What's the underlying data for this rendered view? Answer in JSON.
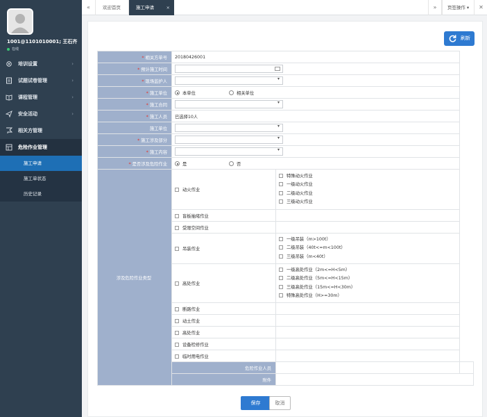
{
  "user": {
    "name": "1001@1101010001; 王石齐",
    "status": "在线"
  },
  "menu": [
    {
      "label": "培训设置",
      "icon": "gear-icon"
    },
    {
      "label": "试题试卷管理",
      "icon": "document-icon"
    },
    {
      "label": "课程管理",
      "icon": "book-icon"
    },
    {
      "label": "安全活动",
      "icon": "send-icon"
    },
    {
      "label": "相关方管理",
      "icon": "flag-icon"
    },
    {
      "label": "危险作业管理",
      "icon": "grid-icon"
    }
  ],
  "submenu": [
    "施工申请",
    "施工单状态",
    "历史记录"
  ],
  "tabs": {
    "home": "欢迎首页",
    "current": "施工申请",
    "ops": "页签操作"
  },
  "refresh_label": "刷新",
  "form": {
    "order_no_label": "相关方单号",
    "order_no": "20180426001",
    "start_time_label": "预计施工时间",
    "supervisor_label": "现场监护人",
    "unit_label": "施工单位",
    "unit_opt1": "本单位",
    "unit_opt2": "相关单位",
    "contract_label": "施工合同",
    "workers_label": "施工人员",
    "workers_value": "已选择10人",
    "unit2_label": "施工单位",
    "area_label": "施工涉及部分",
    "content_label": "施工内容",
    "danger_label": "是否涉及危险作业",
    "danger_yes": "是",
    "danger_no": "否",
    "types_label": "涉及危险作业类型",
    "personnel_label": "危险作业人员",
    "attachment_label": "附件"
  },
  "danger_types": {
    "fire": "动火作业",
    "fire_levels": [
      "特殊动火作业",
      "一级动火作业",
      "二级动火作业",
      "三级动火作业"
    ],
    "blind": "盲板抽堵作业",
    "confined": "受限空间作业",
    "lifting": "吊装作业",
    "lifting_levels": [
      "一级吊装（m>100t）",
      "二级吊装（40t<=m<100t）",
      "三级吊装（m<40t）"
    ],
    "height": "高处作业",
    "height_levels": [
      "一级高处作业（2m<=H<5m）",
      "二级高处作业（5m<=H<15m）",
      "三级高处作业（15m<=H<30m）",
      "特殊高处作业（H>=30m）"
    ],
    "road": "断路作业",
    "earth": "动土作业",
    "height2": "高处作业",
    "equipment": "设备检修作业",
    "temp_power": "临时用电作业"
  },
  "buttons": {
    "save": "保存",
    "cancel": "取消"
  }
}
